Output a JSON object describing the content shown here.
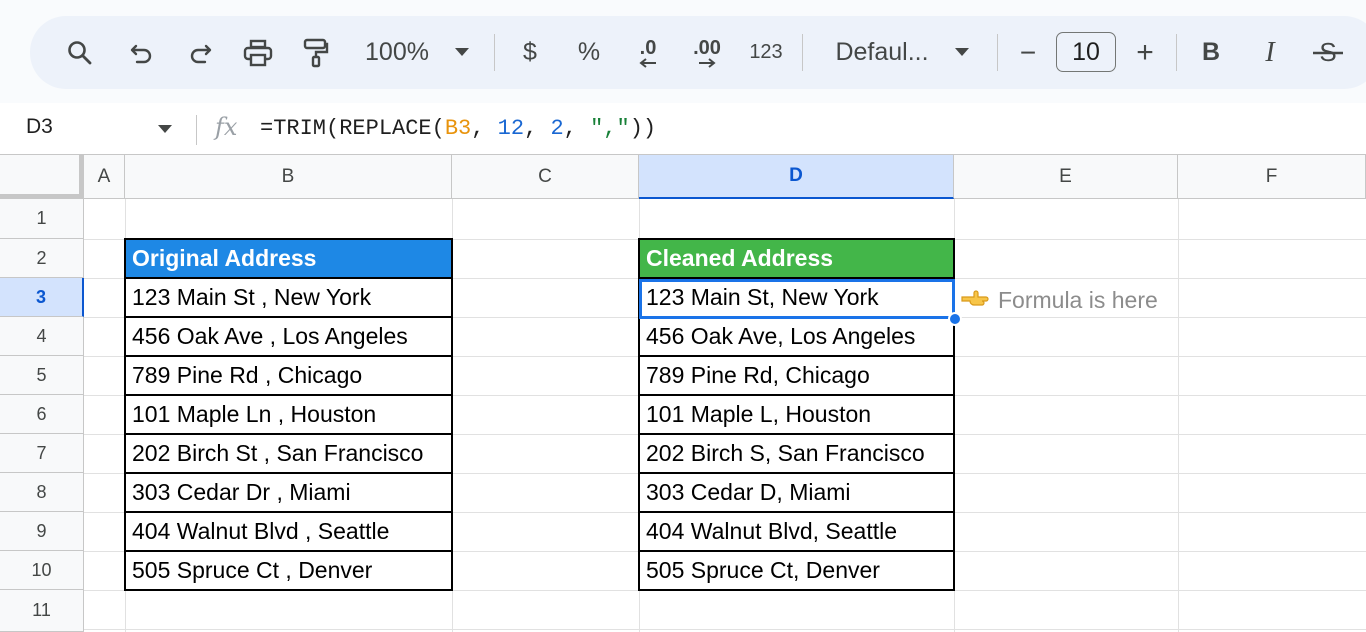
{
  "toolbar": {
    "zoom": "100%",
    "currency": "$",
    "percent": "%",
    "decrease_decimal": ".0",
    "increase_decimal": ".00",
    "number_format": "123",
    "font": "Defaul...",
    "minus": "−",
    "font_size": "10",
    "plus": "+",
    "bold": "B",
    "italic": "I",
    "strike": "S",
    "icons": [
      "search-icon",
      "undo-icon",
      "redo-icon",
      "print-icon",
      "paint-format-icon",
      "dropdown-icon",
      "decrease-decimal-arrow-icon",
      "increase-decimal-arrow-icon",
      "strikethrough-icon"
    ]
  },
  "formula_bar": {
    "cell_ref": "D3",
    "fx": "fx",
    "formula_prefix": "=TRIM(REPLACE(",
    "formula_ref": "B3",
    "formula_sep1": ", ",
    "formula_num1": "12",
    "formula_sep2": ", ",
    "formula_num2": "2",
    "formula_sep3": ", ",
    "formula_str": "\",\"",
    "formula_suffix": "))"
  },
  "columns": [
    "A",
    "B",
    "C",
    "D",
    "E",
    "F"
  ],
  "selected_column": "D",
  "rows": [
    "1",
    "2",
    "3",
    "4",
    "5",
    "6",
    "7",
    "8",
    "9",
    "10",
    "11"
  ],
  "selected_row": "3",
  "table_original": {
    "header": "Original Address",
    "values": [
      "123 Main St , New York",
      "456 Oak Ave , Los Angeles",
      "789 Pine Rd , Chicago",
      "101 Maple Ln , Houston",
      "202 Birch St , San Francisco",
      "303 Cedar Dr , Miami",
      "404 Walnut Blvd , Seattle",
      "505 Spruce Ct , Denver"
    ]
  },
  "table_cleaned": {
    "header": "Cleaned Address",
    "values": [
      "123 Main St, New York",
      "456 Oak Ave, Los Angeles",
      "789 Pine Rd, Chicago",
      "101 Maple L, Houston",
      "202 Birch S, San Francisco",
      "303 Cedar D, Miami",
      "404 Walnut Blvd, Seattle",
      "505 Spruce Ct, Denver"
    ]
  },
  "annotation": {
    "text": "Formula is here",
    "icon": "pointing-hand-icon"
  },
  "colors": {
    "header_original": "#1e88e5",
    "header_cleaned": "#43b649",
    "selection": "#1a73e8"
  }
}
